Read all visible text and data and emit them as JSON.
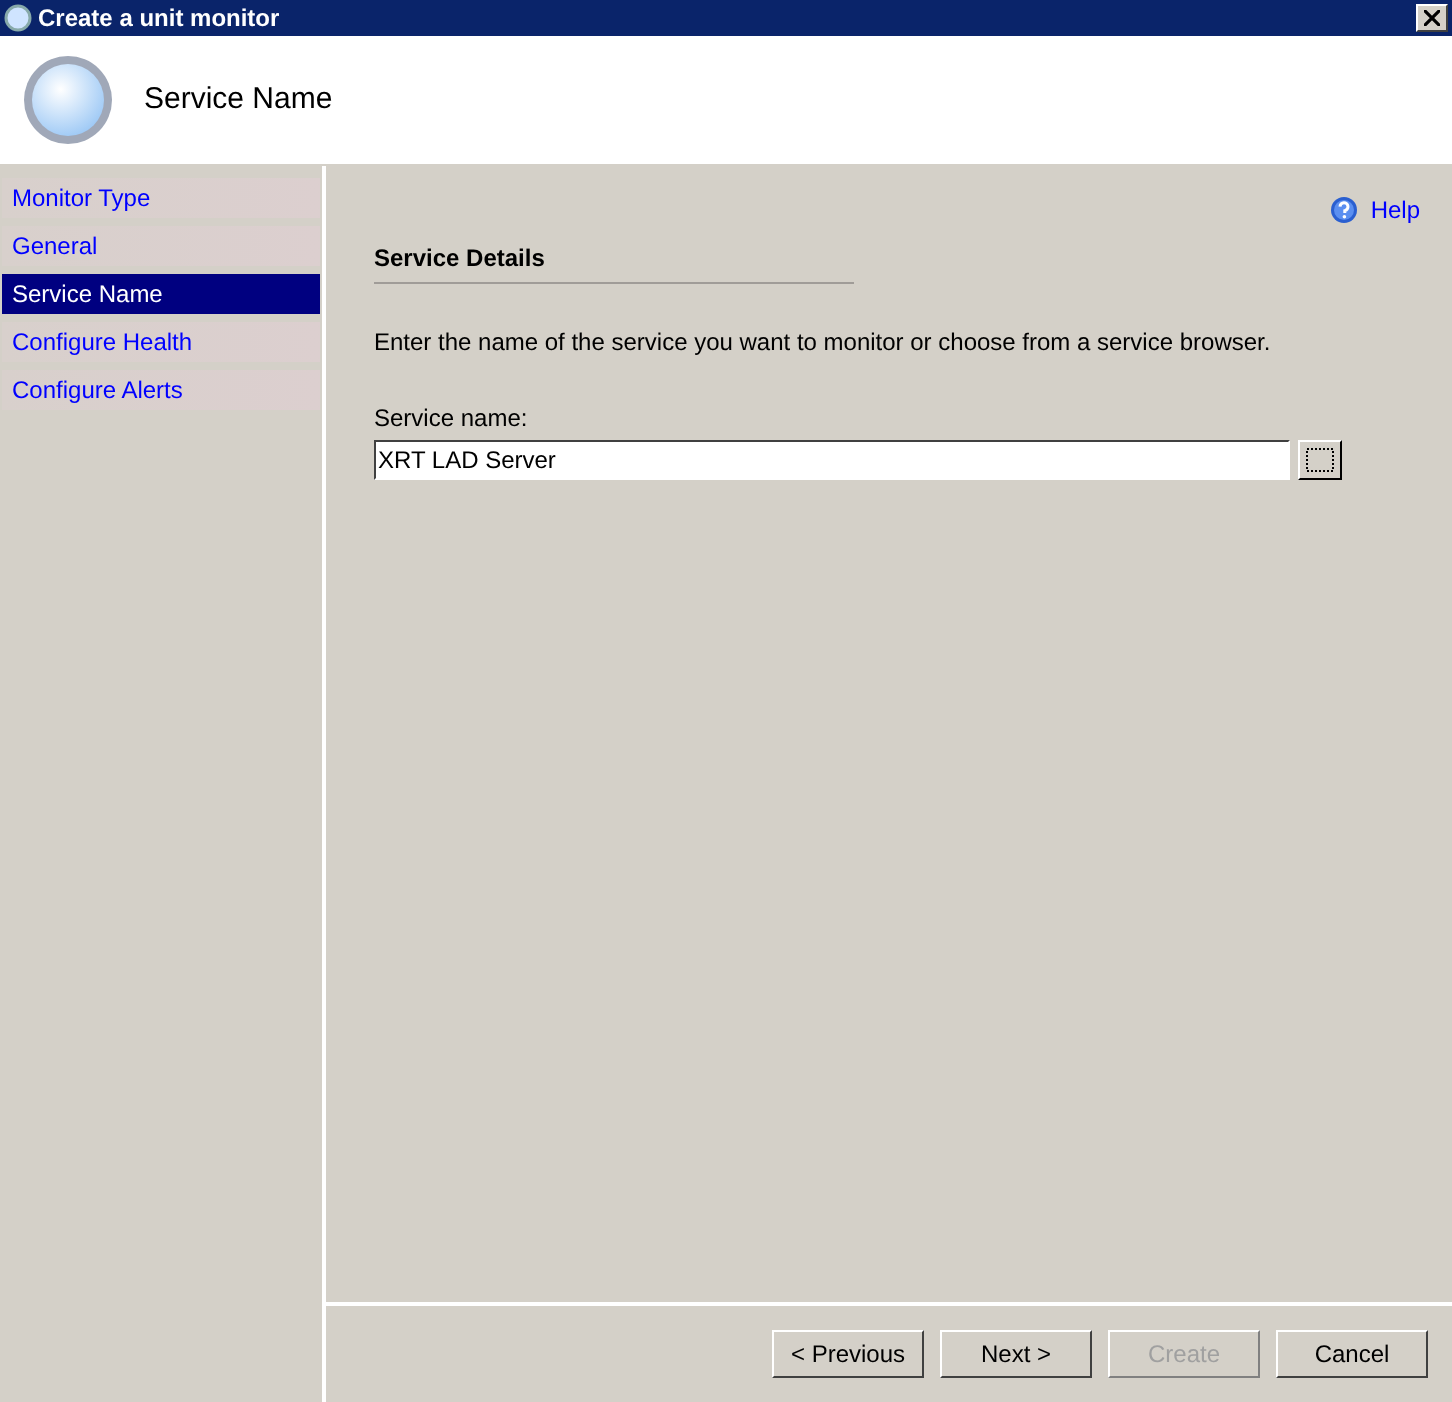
{
  "window": {
    "title": "Create a unit monitor"
  },
  "header": {
    "title": "Service Name"
  },
  "sidebar": {
    "items": [
      {
        "label": "Monitor Type",
        "selected": false
      },
      {
        "label": "General",
        "selected": false
      },
      {
        "label": "Service Name",
        "selected": true
      },
      {
        "label": "Configure Health",
        "selected": false
      },
      {
        "label": "Configure Alerts",
        "selected": false
      }
    ]
  },
  "help": {
    "label": "Help"
  },
  "section": {
    "title": "Service Details",
    "description": "Enter the name of the service you want to monitor or choose from a service browser.",
    "field_label": "Service name:",
    "field_value": "XRT LAD Server"
  },
  "buttons": [
    {
      "label": "< Previous",
      "disabled": false
    },
    {
      "label": "Next >",
      "disabled": false
    },
    {
      "label": "Create",
      "disabled": true
    },
    {
      "label": "Cancel",
      "disabled": false
    }
  ]
}
